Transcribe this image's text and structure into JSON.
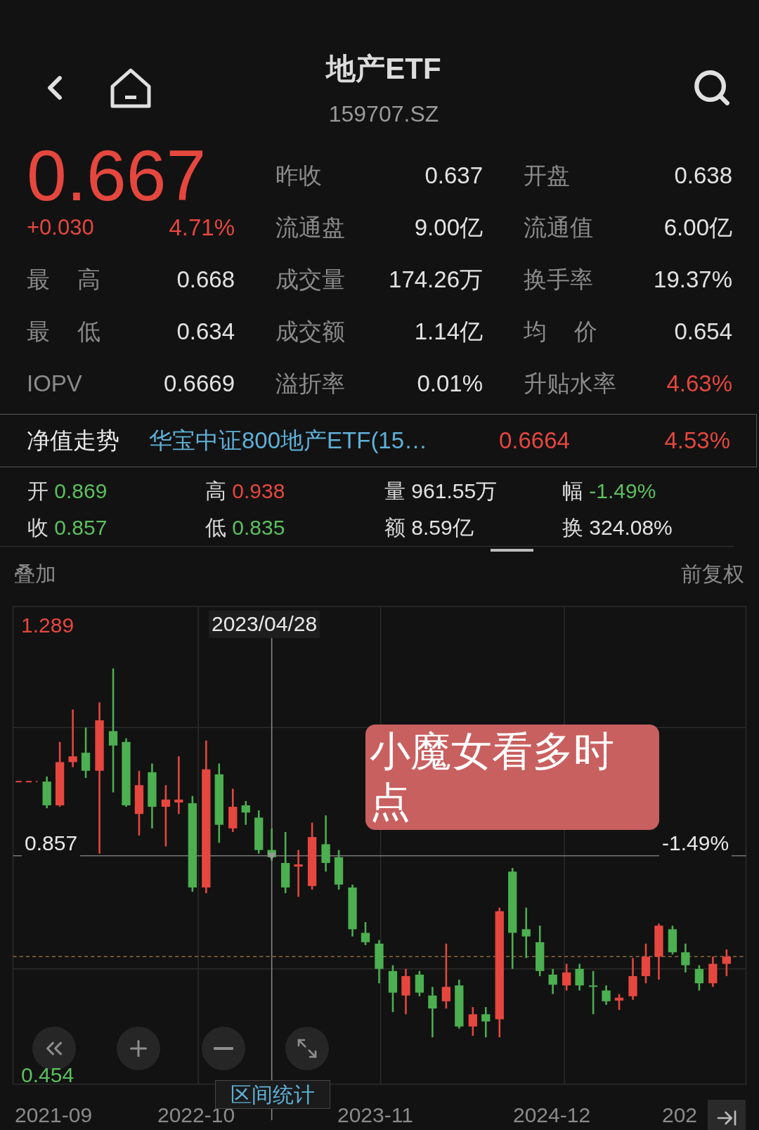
{
  "header": {
    "title": "地产ETF",
    "code": "159707.SZ"
  },
  "quote": {
    "price": "0.667",
    "change": "+0.030",
    "change_pct": "4.71%",
    "color": "#e5473f"
  },
  "rows": [
    [
      {
        "label": "昨收",
        "value": "0.637",
        "color": "#e2e2e2"
      },
      {
        "label": "开盘",
        "value": "0.638",
        "color": "#e2e2e2"
      }
    ],
    [
      {
        "label": "流通盘",
        "value": "9.00亿",
        "color": "#e2e2e2"
      },
      {
        "label": "流通值",
        "value": "6.00亿",
        "color": "#e2e2e2"
      }
    ],
    [
      {
        "label": "最 高",
        "value": "0.668",
        "color": "#e2e2e2"
      },
      {
        "label": "成交量",
        "value": "174.26万",
        "color": "#e2e2e2"
      },
      {
        "label": "换手率",
        "value": "19.37%",
        "color": "#e2e2e2"
      }
    ],
    [
      {
        "label": "最 低",
        "value": "0.634",
        "color": "#e2e2e2"
      },
      {
        "label": "成交额",
        "value": "1.14亿",
        "color": "#e2e2e2"
      },
      {
        "label": "均 价",
        "value": "0.654",
        "color": "#e2e2e2"
      }
    ],
    [
      {
        "label": "IOPV",
        "value": "0.6669",
        "color": "#e2e2e2"
      },
      {
        "label": "溢折率",
        "value": "0.01%",
        "color": "#e2e2e2"
      },
      {
        "label": "升贴水率",
        "value": "4.63%",
        "color": "#e5473f"
      }
    ]
  ],
  "nav": {
    "label": "净值走势",
    "fund": "华宝中证800地产ETF(15…",
    "value": "0.6664",
    "change": "4.53%",
    "color": "#e5473f"
  },
  "stats": [
    {
      "label": "开",
      "value": "0.869",
      "color": "#5cbf5f"
    },
    {
      "label": "高",
      "value": "0.938",
      "color": "#e5473f"
    },
    {
      "label": "量",
      "value": "961.55万",
      "color": "#e2e2e2"
    },
    {
      "label": "幅",
      "value": "-1.49%",
      "color": "#5cbf5f"
    },
    {
      "label": "收",
      "value": "0.857",
      "color": "#5cbf5f"
    },
    {
      "label": "低",
      "value": "0.835",
      "color": "#5cbf5f"
    },
    {
      "label": "额",
      "value": "8.59亿",
      "color": "#e2e2e2"
    },
    {
      "label": "换",
      "value": "324.08%",
      "color": "#e2e2e2"
    }
  ],
  "chart_toolbar": {
    "overlay": "叠加",
    "adjust": "前复权"
  },
  "chart": {
    "high_label": "1.289",
    "low_label": "0.454",
    "cursor_date": "2023/04/28",
    "cursor_price": "0.857",
    "cursor_change": "-1.49%",
    "note": "小魔女看多时点",
    "range_stats": "区间统计",
    "dates": [
      "2021-09",
      "2022-10",
      "2023-11",
      "2024-12",
      "202"
    ]
  }
}
